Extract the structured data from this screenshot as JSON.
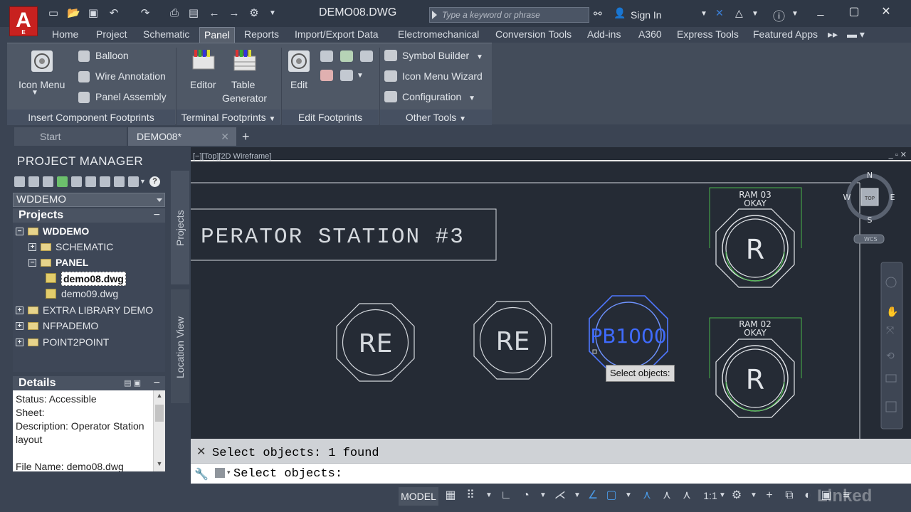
{
  "app": {
    "logo_letter": "A",
    "logo_sub": "E"
  },
  "title_bar": {
    "document_title": "DEMO08.DWG",
    "search_placeholder": "Type a keyword or phrase",
    "sign_in_label": "Sign In"
  },
  "ribbon_tabs": [
    {
      "label": "Home"
    },
    {
      "label": "Project"
    },
    {
      "label": "Schematic"
    },
    {
      "label": "Panel"
    },
    {
      "label": "Reports"
    },
    {
      "label": "Import/Export Data"
    },
    {
      "label": "Electromechanical"
    },
    {
      "label": "Conversion Tools"
    },
    {
      "label": "Add-ins"
    },
    {
      "label": "A360"
    },
    {
      "label": "Express Tools"
    },
    {
      "label": "Featured Apps"
    }
  ],
  "ribbon": {
    "insert_component": {
      "title": "Insert Component Footprints",
      "icon_menu": "Icon Menu",
      "balloon": "Balloon",
      "wire_annotation": "Wire Annotation",
      "panel_assembly": "Panel Assembly"
    },
    "terminal": {
      "title": "Terminal Footprints",
      "editor": "Editor",
      "table_line1": "Table",
      "table_line2": "Generator"
    },
    "edit_footprints": {
      "title": "Edit Footprints",
      "edit": "Edit"
    },
    "other_tools": {
      "title": "Other Tools",
      "symbol_builder": "Symbol Builder",
      "icon_menu_wizard": "Icon Menu  Wizard",
      "configuration": "Configuration"
    }
  },
  "doc_tabs": {
    "start": "Start",
    "demo08": "DEMO08*",
    "add": "+"
  },
  "project_manager": {
    "title": "PROJECT MANAGER",
    "project_select": "WDDEMO",
    "projects_header": "Projects",
    "tree": [
      {
        "label": "WDDEMO",
        "toggle": "−"
      },
      {
        "label": "SCHEMATIC",
        "toggle": "+"
      },
      {
        "label": "PANEL",
        "toggle": "−"
      },
      {
        "label": "demo08.dwg"
      },
      {
        "label": "demo09.dwg"
      },
      {
        "label": "EXTRA LIBRARY DEMO",
        "toggle": "+"
      },
      {
        "label": "NFPADEMO",
        "toggle": "+"
      },
      {
        "label": "POINT2POINT",
        "toggle": "+"
      }
    ],
    "side_tab_projects": "Projects",
    "side_tab_location": "Location View",
    "details_header": "Details",
    "details_lines": [
      "Status: Accessible",
      "Sheet:",
      "Description: Operator Station",
      "layout",
      "",
      "File Name: demo08.dwg"
    ]
  },
  "drawing": {
    "viewport_label": "[−][Top][2D Wireframe]",
    "station_title": "PERATOR  STATION  #3",
    "button_re1": "RE",
    "button_re2": "RE",
    "button_pb": "PB1000",
    "lamp1_tag_line1": "RAM  03",
    "lamp1_tag_line2": "OKAY",
    "lamp1_letter": "R",
    "lamp2_tag_line1": "RAM  02",
    "lamp2_tag_line2": "OKAY",
    "lamp2_letter": "R",
    "viewcube": {
      "n": "N",
      "s": "S",
      "e": "E",
      "w": "W",
      "top": "TOP",
      "wcs": "WCS"
    },
    "tooltip": "Select objects:"
  },
  "command": {
    "history": "Select objects: 1 found",
    "current": "Select objects:"
  },
  "status_bar": {
    "model": "MODEL",
    "scale": "1:1"
  },
  "watermark": "Linked"
}
